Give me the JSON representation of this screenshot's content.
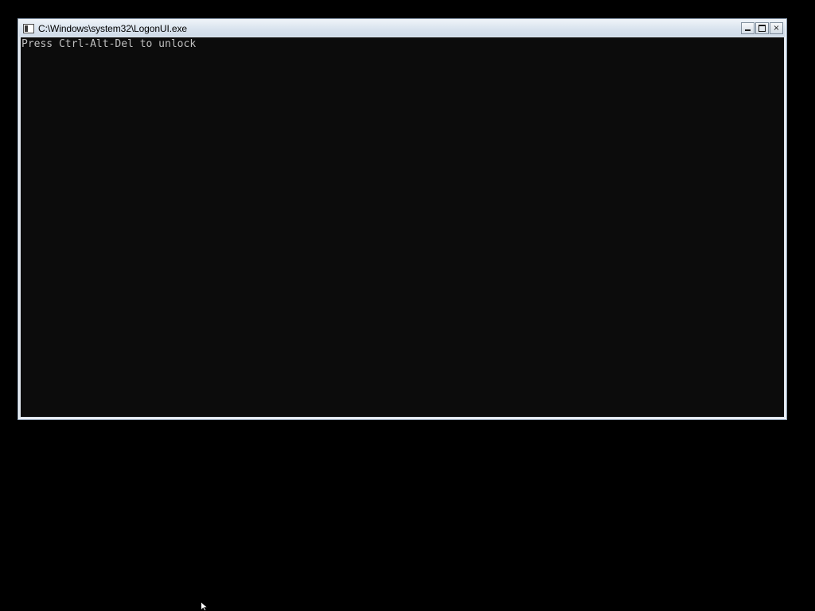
{
  "window": {
    "title": "C:\\Windows\\system32\\LogonUI.exe",
    "controls": {
      "minimize_glyph": "",
      "maximize_glyph": "",
      "close_glyph": "×"
    }
  },
  "console": {
    "lines": [
      "Press Ctrl-Alt-Del to unlock"
    ],
    "background": "#0c0c0c",
    "text_color": "#c0c0c0"
  },
  "icons": {
    "window_icon": "console-window-icon",
    "cursor": "mouse-pointer-icon"
  }
}
